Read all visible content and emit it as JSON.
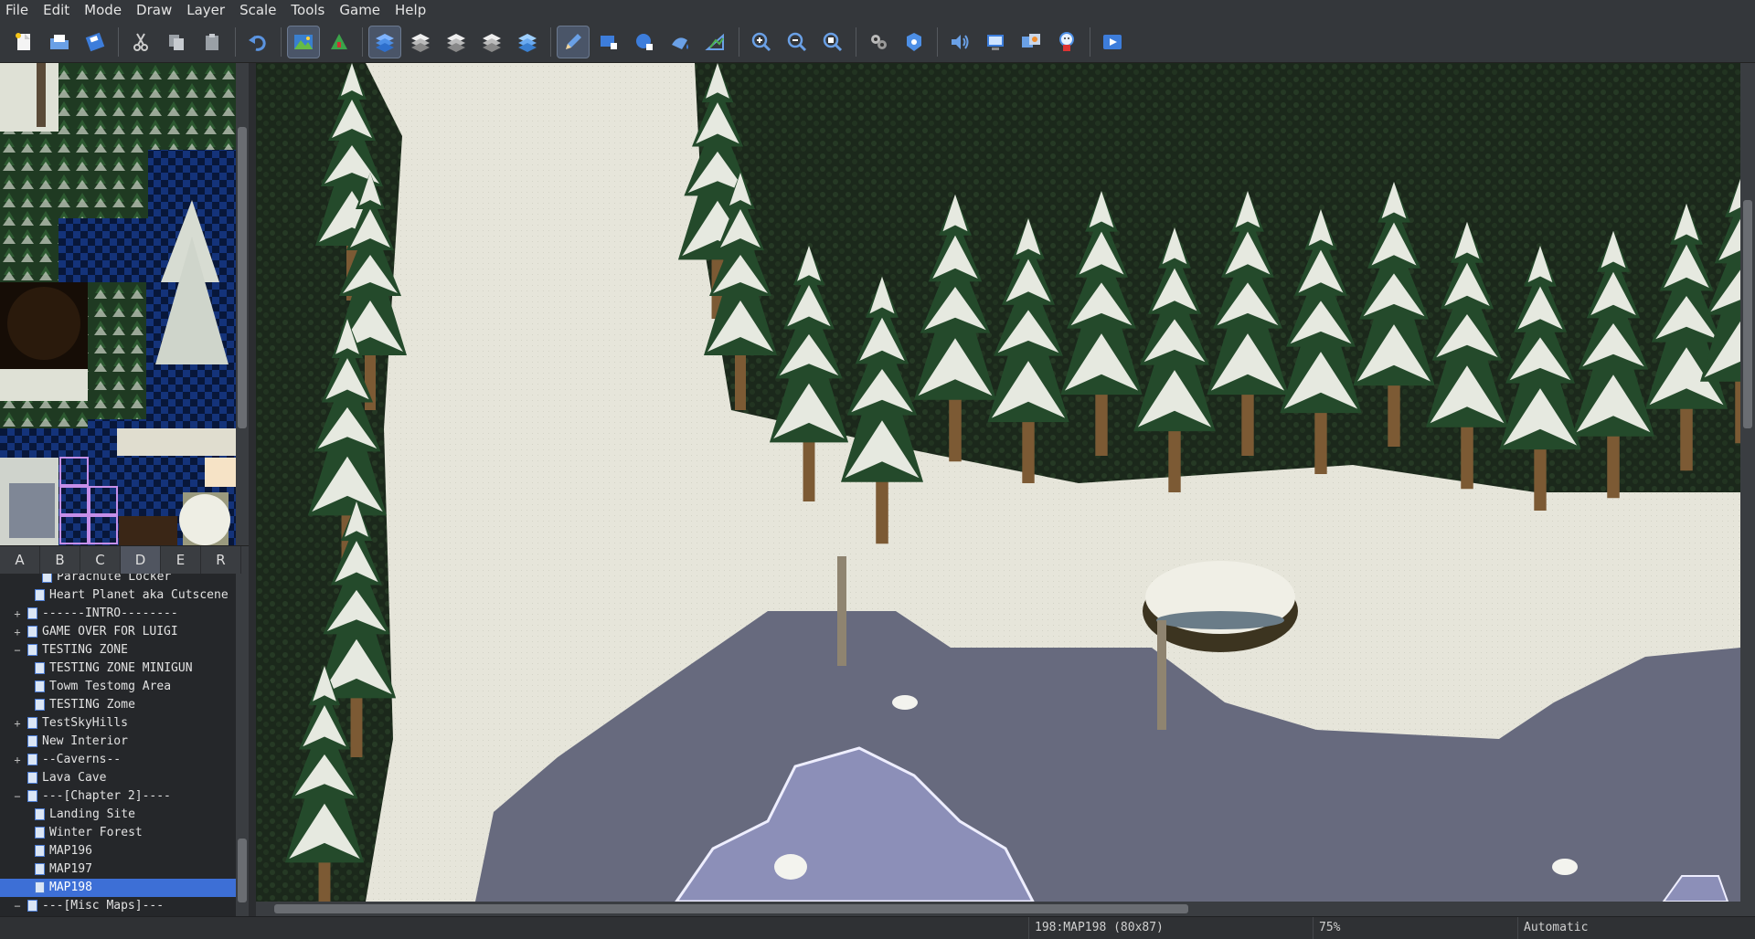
{
  "menu": [
    "File",
    "Edit",
    "Mode",
    "Draw",
    "Layer",
    "Scale",
    "Tools",
    "Game",
    "Help"
  ],
  "toolbar": {
    "groups": [
      [
        "new-icon",
        "open-icon",
        "save-icon"
      ],
      [
        "cut-icon",
        "copy-icon",
        "paste-icon"
      ],
      [
        "undo-icon"
      ],
      [
        "map-mode-icon",
        "event-mode-icon"
      ],
      [
        "layer1-icon",
        "layer2-icon",
        "layer3-icon",
        "layer4-icon",
        "all-layers-icon"
      ],
      [
        "pencil-icon",
        "rectangle-icon",
        "ellipse-icon",
        "fill-icon",
        "select-icon"
      ],
      [
        "zoom-in-icon",
        "zoom-out-icon",
        "zoom-actual-icon"
      ],
      [
        "database-icon",
        "materials-icon"
      ],
      [
        "sound-icon",
        "script-icon",
        "resource-icon",
        "character-icon"
      ],
      [
        "playtest-icon"
      ]
    ]
  },
  "tileset_tabs": [
    "A",
    "B",
    "C",
    "D",
    "E",
    "R"
  ],
  "tileset_selected_tab": "D",
  "map_tree": [
    {
      "label": "Parachute Locker",
      "indent": 2,
      "expander": ""
    },
    {
      "label": "Heart Planet aka Cutscene",
      "indent": 1,
      "expander": ""
    },
    {
      "label": "------INTRO--------",
      "indent": 0,
      "expander": "+"
    },
    {
      "label": "GAME OVER FOR LUIGI",
      "indent": 0,
      "expander": "+"
    },
    {
      "label": "TESTING ZONE",
      "indent": 0,
      "expander": "−"
    },
    {
      "label": "TESTING ZONE MINIGUN",
      "indent": 1,
      "expander": ""
    },
    {
      "label": "Towm Testomg Area",
      "indent": 1,
      "expander": ""
    },
    {
      "label": "TESTING Zome",
      "indent": 1,
      "expander": ""
    },
    {
      "label": "TestSkyHills",
      "indent": 0,
      "expander": "+"
    },
    {
      "label": "New Interior",
      "indent": 0,
      "expander": ""
    },
    {
      "label": "--Caverns--",
      "indent": 0,
      "expander": "+"
    },
    {
      "label": "Lava Cave",
      "indent": 0,
      "expander": ""
    },
    {
      "label": "---[Chapter 2]----",
      "indent": 0,
      "expander": "−"
    },
    {
      "label": "Landing Site",
      "indent": 1,
      "expander": ""
    },
    {
      "label": "Winter Forest",
      "indent": 1,
      "expander": ""
    },
    {
      "label": "MAP196",
      "indent": 1,
      "expander": ""
    },
    {
      "label": "MAP197",
      "indent": 1,
      "expander": ""
    },
    {
      "label": "MAP198",
      "indent": 1,
      "expander": ""
    },
    {
      "label": "---[Misc Maps]---",
      "indent": 0,
      "expander": "−"
    }
  ],
  "map_tree_selected": "MAP198",
  "status": {
    "map": "198:MAP198 (80x87)",
    "zoom": "75%",
    "mode": "Automatic"
  },
  "colors": {
    "snow": "#e8e7dc",
    "forest_dark": "#1c2a1c",
    "ice_dark": "#676a7e",
    "ice_water": "#8c8fb8",
    "selection": "#3d6fd6"
  }
}
